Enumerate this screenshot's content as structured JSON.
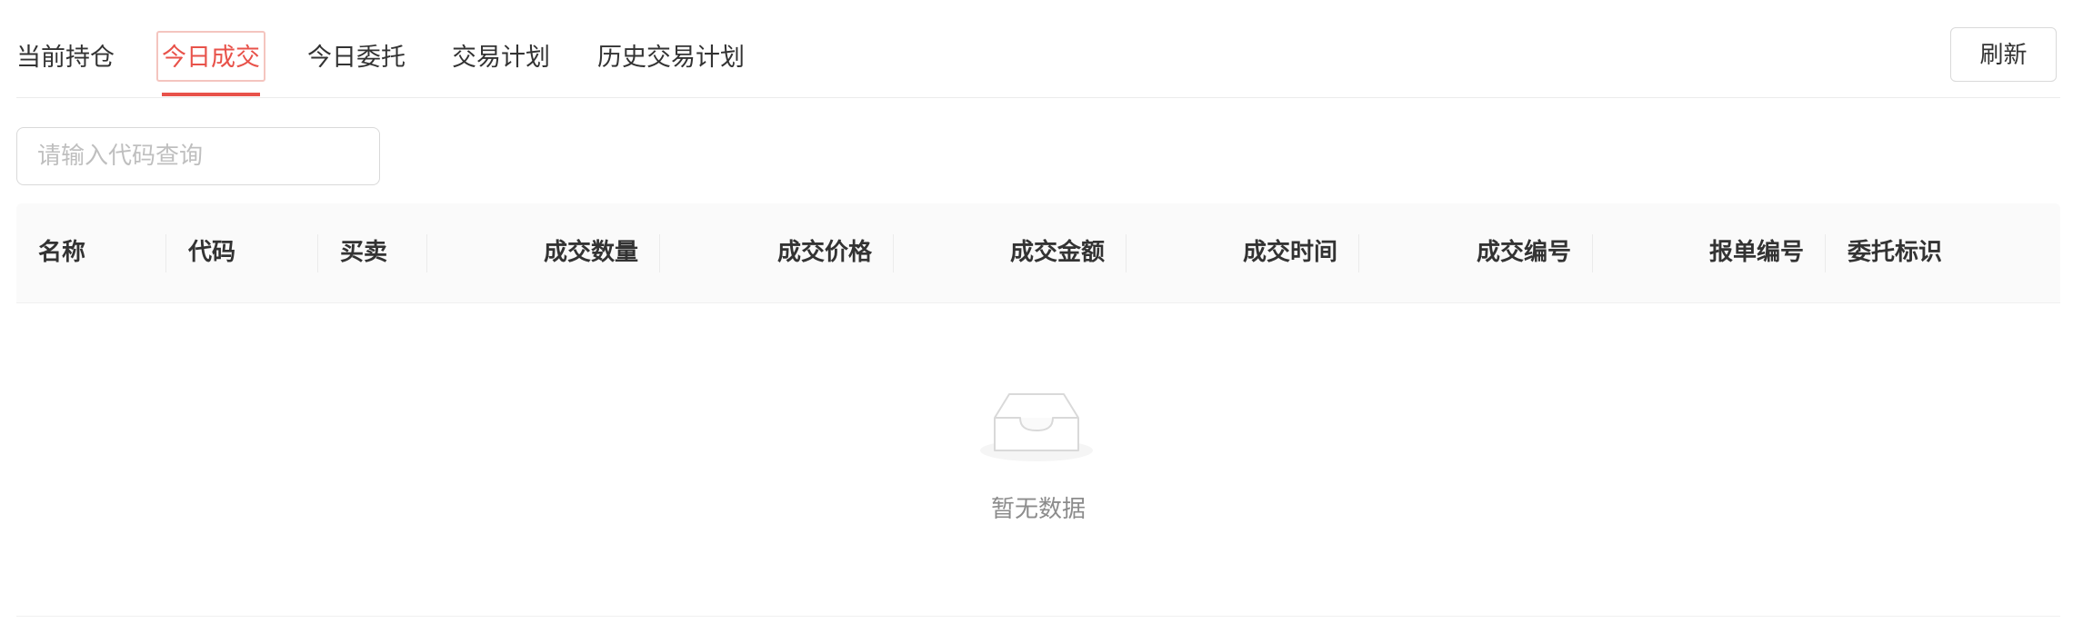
{
  "tabs": [
    {
      "label": "当前持仓",
      "active": false
    },
    {
      "label": "今日成交",
      "active": true
    },
    {
      "label": "今日委托",
      "active": false
    },
    {
      "label": "交易计划",
      "active": false
    },
    {
      "label": "历史交易计划",
      "active": false
    }
  ],
  "toolbar": {
    "refresh_label": "刷新"
  },
  "search": {
    "placeholder": "请输入代码查询",
    "value": ""
  },
  "table": {
    "columns": [
      "名称",
      "代码",
      "买卖",
      "成交数量",
      "成交价格",
      "成交金额",
      "成交时间",
      "成交编号",
      "报单编号",
      "委托标识"
    ],
    "rows": []
  },
  "empty": {
    "text": "暂无数据",
    "icon": "empty-inbox-icon"
  },
  "colors": {
    "accent": "#e8524a",
    "header_bg": "#fafafa",
    "border": "#d9d9d9"
  }
}
